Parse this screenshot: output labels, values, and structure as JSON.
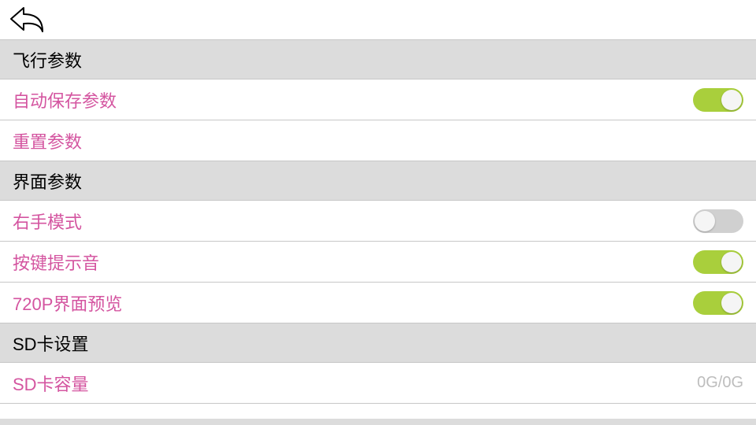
{
  "sections": {
    "flight": {
      "header": "飞行参数",
      "auto_save": {
        "label": "自动保存参数",
        "on": true
      },
      "reset": {
        "label": "重置参数"
      }
    },
    "interface": {
      "header": "界面参数",
      "right_hand": {
        "label": "右手模式",
        "on": false
      },
      "key_sound": {
        "label": "按键提示音",
        "on": true
      },
      "preview720": {
        "label": "720P界面预览",
        "on": true
      }
    },
    "sd": {
      "header": "SD卡设置",
      "capacity": {
        "label": "SD卡容量",
        "value": "0G/0G"
      }
    }
  }
}
